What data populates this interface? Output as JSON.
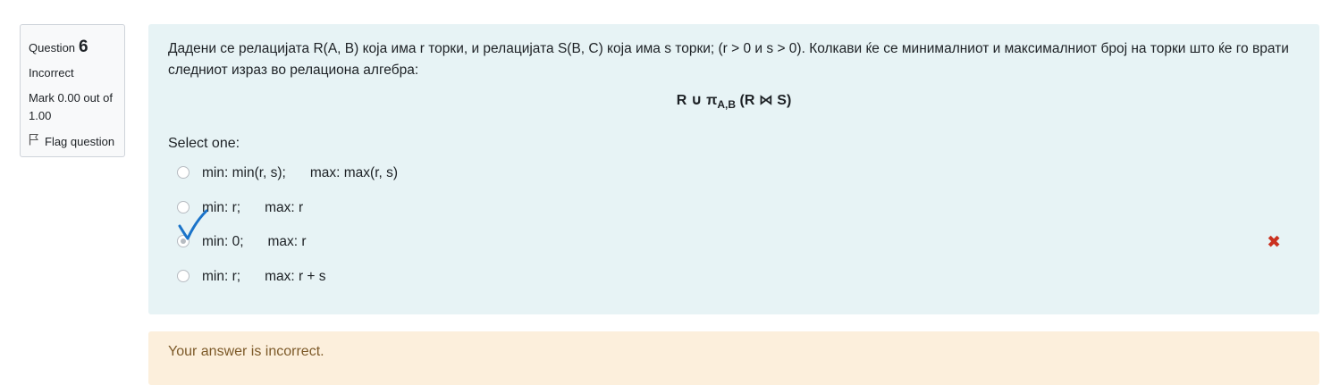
{
  "info": {
    "question_label": "Question",
    "question_number": "6",
    "state": "Incorrect",
    "grade": "Mark 0.00 out of 1.00",
    "flag_label": "Flag question",
    "flag_icon": "flag-outline-icon"
  },
  "question": {
    "text": "Дадени се релацијата R(A, B) која има r торки, и релацијата S(B, C) која има s торки; (r > 0 и s > 0). Колкави ќе се минималниот и максималниот број на торки што ќе го врати следниот израз во релациона алгебра:",
    "formula_main": "R ∪ π",
    "formula_sub": "A,B",
    "formula_rest": " (R ⋈ S)",
    "prompt": "Select one:",
    "options": [
      {
        "min": "min: min(r, s);",
        "max": "max: max(r, s)",
        "selected": false
      },
      {
        "min": "min: r;",
        "max": "max: r",
        "selected": false
      },
      {
        "min": "min: 0;",
        "max": "max: r",
        "selected": true
      },
      {
        "min": "min: r;",
        "max": "max: r + s",
        "selected": false
      }
    ],
    "incorrect_mark": "✖"
  },
  "feedback": {
    "text": "Your answer is incorrect."
  },
  "colors": {
    "formulation_bg": "#e7f3f5",
    "feedback_bg": "#fcefdc",
    "incorrect_red": "#ca3120",
    "handwritten_check": "#1a73c9"
  }
}
